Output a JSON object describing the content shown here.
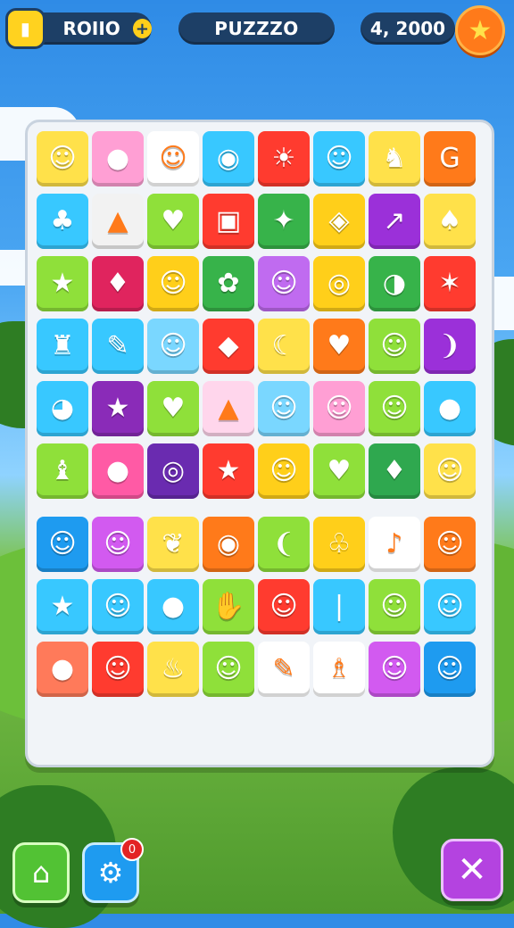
{
  "header": {
    "left_label": "ROIIO",
    "left_badge_icon": "card-icon",
    "left_coin_symbol": "+",
    "center_title": "PUZZZO",
    "score": "4, 2000",
    "star_icon": "star-icon"
  },
  "board": {
    "rows": 9,
    "cols": 8,
    "tiles": [
      [
        {
          "c": "#ffe14a",
          "g": "☺"
        },
        {
          "c": "#ff9fd4",
          "g": "●"
        },
        {
          "c": "#ffffff",
          "g": "☺"
        },
        {
          "c": "#38c8ff",
          "g": "◉"
        },
        {
          "c": "#ff3b2f",
          "g": "☀"
        },
        {
          "c": "#38c8ff",
          "g": "☺"
        },
        {
          "c": "#ffe14a",
          "g": "♞"
        },
        {
          "c": "#ff7a1a",
          "g": "G"
        }
      ],
      [
        {
          "c": "#38c8ff",
          "g": "♣"
        },
        {
          "c": "#f2f2f2",
          "g": "▲"
        },
        {
          "c": "#8fe03a",
          "g": "♥"
        },
        {
          "c": "#ff3b2f",
          "g": "▣"
        },
        {
          "c": "#37b34a",
          "g": "✦"
        },
        {
          "c": "#ffcf1a",
          "g": "◈"
        },
        {
          "c": "#9b30d9",
          "g": "↗"
        },
        {
          "c": "#ffe14a",
          "g": "♠"
        }
      ],
      [
        {
          "c": "#8fe03a",
          "g": "★"
        },
        {
          "c": "#e0245e",
          "g": "♦"
        },
        {
          "c": "#ffcf1a",
          "g": "☺"
        },
        {
          "c": "#37b34a",
          "g": "✿"
        },
        {
          "c": "#c06bf0",
          "g": "☺"
        },
        {
          "c": "#ffcf1a",
          "g": "◎"
        },
        {
          "c": "#37b34a",
          "g": "◑"
        },
        {
          "c": "#ff3b2f",
          "g": "✶"
        }
      ],
      [
        {
          "c": "#38c8ff",
          "g": "♜"
        },
        {
          "c": "#38c8ff",
          "g": "✎"
        },
        {
          "c": "#7ad7ff",
          "g": "☺"
        },
        {
          "c": "#ff3b2f",
          "g": "◆"
        },
        {
          "c": "#ffe14a",
          "g": "☾"
        },
        {
          "c": "#ff7a1a",
          "g": "♥"
        },
        {
          "c": "#8fe03a",
          "g": "☺"
        },
        {
          "c": "#9b30d9",
          "g": "❩"
        }
      ],
      [
        {
          "c": "#38c8ff",
          "g": "◕"
        },
        {
          "c": "#8a2bb8",
          "g": "★"
        },
        {
          "c": "#8fe03a",
          "g": "♥"
        },
        {
          "c": "#ffd6ec",
          "g": "▲"
        },
        {
          "c": "#7ad7ff",
          "g": "☺"
        },
        {
          "c": "#ff9fd4",
          "g": "☺"
        },
        {
          "c": "#8fe03a",
          "g": "☺"
        },
        {
          "c": "#38c8ff",
          "g": "●"
        }
      ],
      [
        {
          "c": "#8fe03a",
          "g": "♝"
        },
        {
          "c": "#ff5aa5",
          "g": "●"
        },
        {
          "c": "#6a2bb0",
          "g": "◎"
        },
        {
          "c": "#ff3b2f",
          "g": "★"
        },
        {
          "c": "#ffcf1a",
          "g": "☺"
        },
        {
          "c": "#8fe03a",
          "g": "♥"
        },
        {
          "c": "#2fa84f",
          "g": "♦"
        },
        {
          "c": "#ffe14a",
          "g": "☺"
        }
      ],
      [
        {
          "c": "#1e9bf0",
          "g": "☺"
        },
        {
          "c": "#d25af0",
          "g": "☺"
        },
        {
          "c": "#ffe14a",
          "g": "❦"
        },
        {
          "c": "#ff7a1a",
          "g": "◉"
        },
        {
          "c": "#8fe03a",
          "g": "❨"
        },
        {
          "c": "#ffcf1a",
          "g": "♧"
        },
        {
          "c": "#ffffff",
          "g": "♪"
        },
        {
          "c": "#ff7a1a",
          "g": "☺"
        }
      ],
      [
        {
          "c": "#38c8ff",
          "g": "★"
        },
        {
          "c": "#38c8ff",
          "g": "☺"
        },
        {
          "c": "#38c8ff",
          "g": "●"
        },
        {
          "c": "#8fe03a",
          "g": "✋"
        },
        {
          "c": "#ff3b2f",
          "g": "☺"
        },
        {
          "c": "#38c8ff",
          "g": "❘"
        },
        {
          "c": "#8fe03a",
          "g": "☺"
        },
        {
          "c": "#38c8ff",
          "g": "☺"
        }
      ],
      [
        {
          "c": "#ff7a5a",
          "g": "●"
        },
        {
          "c": "#ff3b2f",
          "g": "☺"
        },
        {
          "c": "#ffe14a",
          "g": "♨"
        },
        {
          "c": "#8fe03a",
          "g": "☺"
        },
        {
          "c": "#ffffff",
          "g": "✎"
        },
        {
          "c": "#ffffff",
          "g": "♗"
        },
        {
          "c": "#d25af0",
          "g": "☺"
        },
        {
          "c": "#1e9bf0",
          "g": "☺"
        }
      ]
    ]
  },
  "buttons": {
    "home_icon": "⌂",
    "settings_icon": "⚙",
    "settings_badge": "0",
    "close_icon": "✕"
  }
}
